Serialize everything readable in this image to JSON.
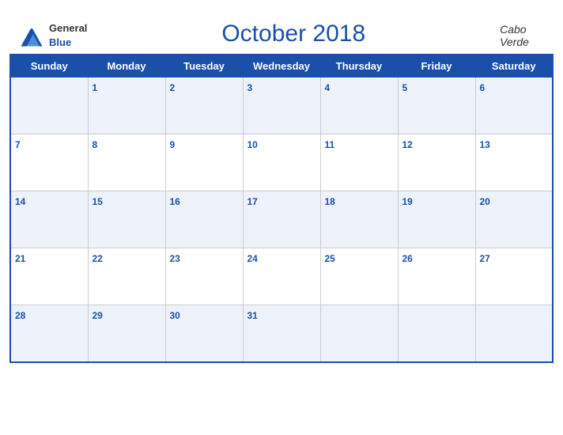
{
  "header": {
    "logo_general": "General",
    "logo_blue": "Blue",
    "title": "October 2018",
    "country": "Cabo Verde"
  },
  "days_of_week": [
    "Sunday",
    "Monday",
    "Tuesday",
    "Wednesday",
    "Thursday",
    "Friday",
    "Saturday"
  ],
  "weeks": [
    [
      null,
      1,
      2,
      3,
      4,
      5,
      6
    ],
    [
      7,
      8,
      9,
      10,
      11,
      12,
      13
    ],
    [
      14,
      15,
      16,
      17,
      18,
      19,
      20
    ],
    [
      21,
      22,
      23,
      24,
      25,
      26,
      27
    ],
    [
      28,
      29,
      30,
      31,
      null,
      null,
      null
    ]
  ]
}
